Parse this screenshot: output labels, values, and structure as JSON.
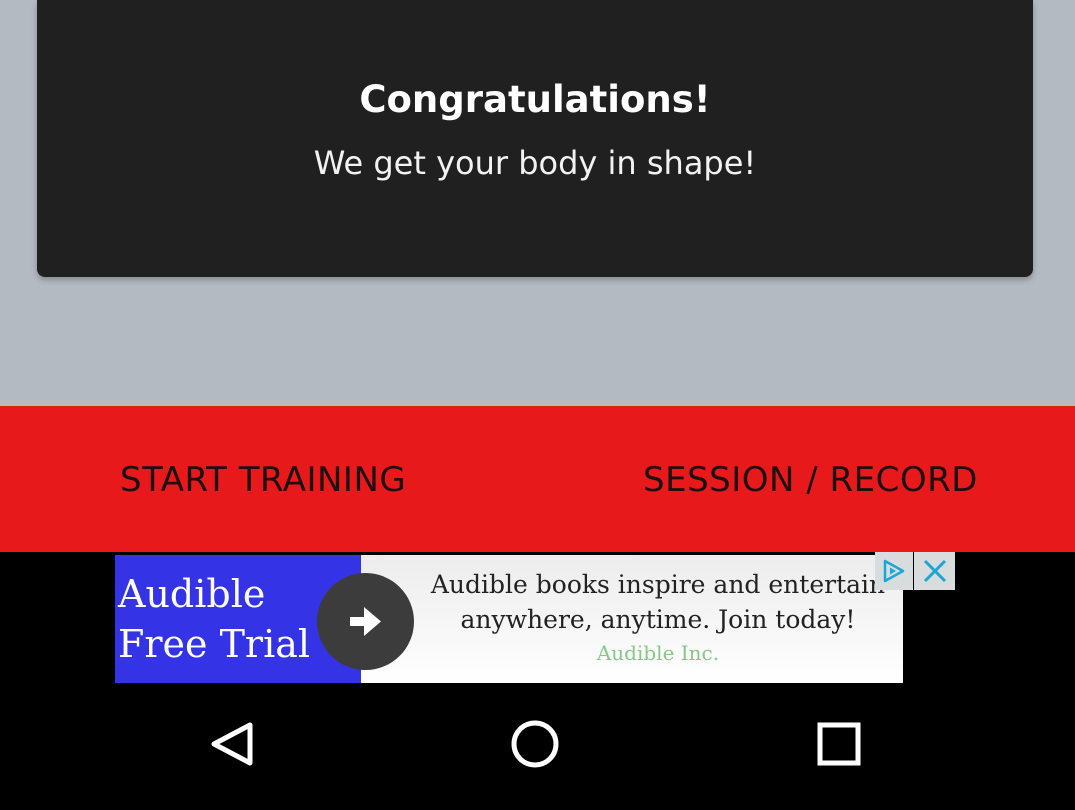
{
  "card": {
    "title": "Congratulations!",
    "subtitle": "We get your body in shape!"
  },
  "actions": {
    "start_training": "START TRAINING",
    "session_record": "SESSION / RECORD"
  },
  "ad": {
    "brand": "Audible\nFree Trial",
    "headline_line1": "Audible books inspire and entertain",
    "headline_line2": "anywhere, anytime. Join today!",
    "advertiser": "Audible Inc.",
    "icons": {
      "arrow": "arrow-right-icon",
      "choices": "adchoices-icon",
      "close": "close-icon"
    },
    "colors": {
      "brand_bg": "#3434e6",
      "advertiser_text": "#86c986"
    }
  },
  "nav": {
    "icons": [
      "back-icon",
      "home-icon",
      "recent-apps-icon"
    ]
  },
  "colors": {
    "background": "#b4bac2",
    "card": "#202020",
    "action_bar": "#e8191b"
  }
}
